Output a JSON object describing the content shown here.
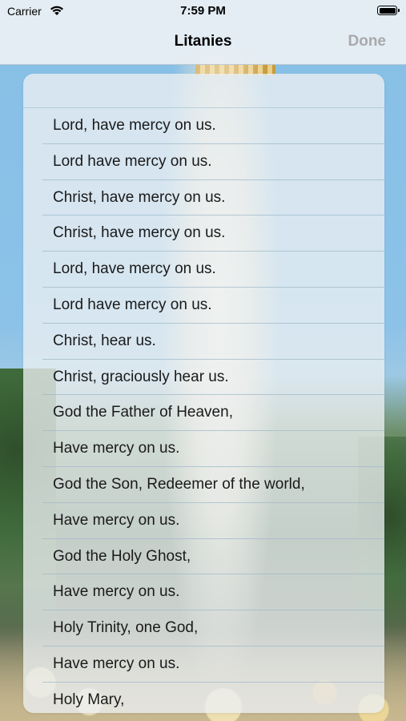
{
  "status_bar": {
    "carrier": "Carrier",
    "time": "7:59 PM"
  },
  "nav": {
    "title": "Litanies",
    "done_label": "Done",
    "done_color": "#a9a9ad"
  },
  "litany": {
    "lines": [
      "Lord, have mercy on us.",
      "Lord have mercy on us.",
      "Christ, have mercy on us.",
      "Christ, have mercy on us.",
      "Lord, have mercy on us.",
      "Lord have mercy on us.",
      "Christ, hear us.",
      "Christ, graciously hear us.",
      "God the Father of Heaven,",
      "Have mercy on us.",
      "God the Son, Redeemer of the world,",
      "Have mercy on us.",
      "God the Holy Ghost,",
      "Have mercy on us.",
      "Holy Trinity, one God,",
      "Have mercy on us.",
      "Holy Mary,"
    ]
  }
}
